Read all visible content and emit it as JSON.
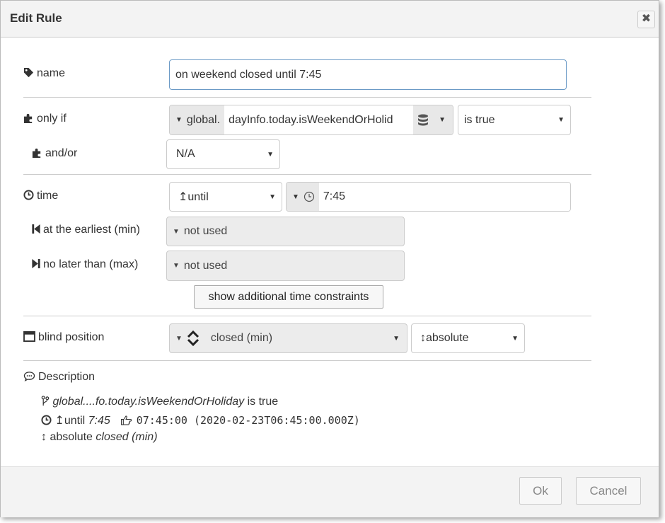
{
  "dialog": {
    "title": "Edit Rule",
    "close_glyph": "✖",
    "ok_label": "Ok",
    "cancel_label": "Cancel"
  },
  "name": {
    "label": "name",
    "value": "on weekend closed until 7:45"
  },
  "only_if": {
    "label": "only if",
    "type_label": "global.",
    "value": "dayInfo.today.isWeekendOrHolid",
    "operator": "is true"
  },
  "and_or": {
    "label": "and/or",
    "value": "N/A"
  },
  "time": {
    "label": "time",
    "mode": "↥until",
    "value": "7:45"
  },
  "earliest": {
    "label": "at the earliest (min)",
    "value": "not used"
  },
  "latest": {
    "label": "no later than (max)",
    "value": "not used"
  },
  "show_constraints_label": "show additional time constraints",
  "blind_position": {
    "label": "blind position",
    "value": "closed (min)",
    "mode": "↕absolute"
  },
  "description": {
    "label": "Description",
    "line1_expr": "global....fo.today.isWeekendOrHoliday",
    "line1_suffix": " is true",
    "line2_prefix": "↥until ",
    "line2_time": "7:45",
    "line2_timestamp": "07:45:00 (2020-02-23T06:45:00.000Z)",
    "line3_prefix": "↕ absolute ",
    "line3_value": "closed (min)"
  },
  "icons": [
    "tag-icon",
    "puzzle-icon",
    "clock-icon",
    "step-backward-icon",
    "step-forward-icon",
    "window-icon",
    "comment-icon",
    "database-icon",
    "branch-icon",
    "hand-right-icon",
    "close-icon"
  ]
}
